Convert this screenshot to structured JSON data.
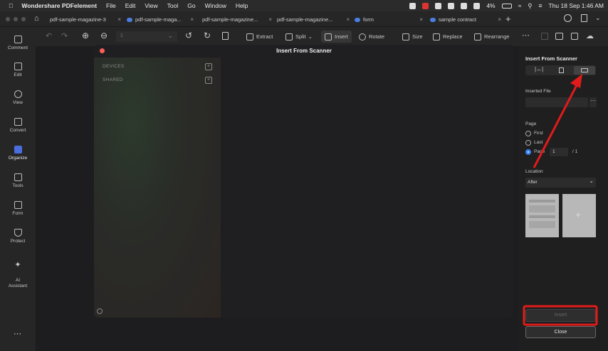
{
  "menubar": {
    "app_name": "Wondershare PDFelement",
    "menus": [
      "File",
      "Edit",
      "View",
      "Tool",
      "Go",
      "Window",
      "Help"
    ],
    "battery": "4%",
    "datetime": "Thu 18 Sep  1:46 AM"
  },
  "tabs": [
    {
      "label": "pdf-sample-magazine-3"
    },
    {
      "label": "pdf-sample-maga..."
    },
    {
      "label": "pdf-sample-magazine..."
    },
    {
      "label": "pdf-sample-magazine..."
    },
    {
      "label": "form"
    },
    {
      "label": "sample contract"
    }
  ],
  "toolbar": {
    "page_number": "1",
    "extract": "Extract",
    "split": "Split",
    "insert": "Insert",
    "rotate": "Rotate",
    "size": "Size",
    "replace": "Replace",
    "rearrange": "Rearrange"
  },
  "sidebar": {
    "items": [
      "Comment",
      "Edit",
      "View",
      "Convert",
      "Organize",
      "Tools",
      "Form",
      "Protect",
      "AI\nAssistant"
    ]
  },
  "modal": {
    "title": "Insert From Scanner",
    "devices_label": "DEVICES",
    "shared_label": "SHARED"
  },
  "panel": {
    "title": "Insert From Scanner",
    "inserted_file_label": "Inserted File",
    "page_label": "Page",
    "options": [
      "First",
      "Last",
      "Page"
    ],
    "page_value": "1",
    "page_total": "/ 1",
    "location_label": "Location",
    "location_value": "After",
    "insert_button": "Insert",
    "close_button": "Close"
  },
  "colors": {
    "accent": "#3b82f6",
    "annotation": "#e11b1b"
  }
}
